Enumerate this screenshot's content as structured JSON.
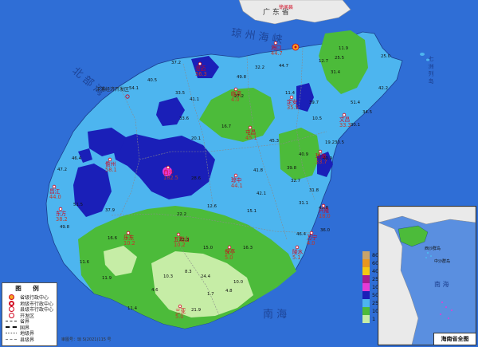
{
  "mainland_label": "广 东 省",
  "county_label": "徐闻县",
  "sea_labels": {
    "strait": "琼 州 海 峡",
    "north": "北 部 湾",
    "south": "南 海"
  },
  "islands_label": "七 洲 列 岛",
  "dev_zone_label": "洋浦经济开发区",
  "cities": [
    {
      "name": "海口",
      "value": "44.7"
    },
    {
      "name": "澄迈",
      "value": "56.3"
    },
    {
      "name": "定安",
      "value": "35.5"
    },
    {
      "name": "文昌",
      "value": "33.3"
    },
    {
      "name": "屯昌",
      "value": "45.1"
    },
    {
      "name": "临高",
      "value": "4.0"
    },
    {
      "name": "儋州",
      "value": "58.1"
    },
    {
      "name": "白沙",
      "value": "182.5"
    },
    {
      "name": "琼中",
      "value": "44.1"
    },
    {
      "name": "琼海",
      "value": "33.7"
    },
    {
      "name": "昌江",
      "value": "44.0"
    },
    {
      "name": "东方",
      "value": "38.2"
    },
    {
      "name": "五指山",
      "value": "10.2"
    },
    {
      "name": "乐东",
      "value": "10.2"
    },
    {
      "name": "保亭",
      "value": "5.0"
    },
    {
      "name": "万宁",
      "value": "4.0"
    },
    {
      "name": "陵水",
      "value": "5.1"
    },
    {
      "name": "三亚",
      "value": "5.0"
    },
    {
      "name": "兴隆",
      "value": "18.0"
    }
  ],
  "station_values": [
    "37.2",
    "40.5",
    "49.8",
    "32.2",
    "44.7",
    "12.7",
    "25.5",
    "25.0",
    "11.9",
    "31.4",
    "54.1",
    "33.5",
    "41.1",
    "27.2",
    "39.7",
    "11.4",
    "51.4",
    "42.2",
    "34.5",
    "10.5",
    "33.6",
    "16.7",
    "30.5",
    "40.9",
    "32.7",
    "41.8",
    "39.8",
    "46.4",
    "47.2",
    "51.5",
    "37.9",
    "49.8",
    "43.8",
    "19.2",
    "31.8",
    "42.1",
    "46.4",
    "22.2",
    "16.6",
    "11.6",
    "15.0",
    "22.3",
    "16.3",
    "10.3",
    "11.9",
    "8.3",
    "10.0",
    "24.4",
    "4.8",
    "1.7",
    "4.6",
    "11.4",
    "21.9",
    "30.1",
    "40.9",
    "20.1",
    "45.3",
    "12.6",
    "15.1",
    "28.6",
    "31.1",
    "36.0"
  ],
  "legend": {
    "title": "图  例",
    "items": [
      {
        "label": "省级行政中心",
        "icon": "star-in-circle-icon"
      },
      {
        "label": "地级市行政中心",
        "icon": "double-circle-icon"
      },
      {
        "label": "县级市行政中心",
        "icon": "circle-dot-icon"
      },
      {
        "label": "开发区",
        "icon": "open-circle-icon"
      },
      {
        "label": "省界",
        "icon": "dash-line-icon"
      },
      {
        "label": "国界",
        "icon": "thick-dash-line-icon"
      },
      {
        "label": "地级界",
        "icon": "dotted-line-icon"
      },
      {
        "label": "县级界",
        "icon": "thin-dash-line-icon"
      }
    ]
  },
  "scale": [
    {
      "label": "800",
      "color": "#c8a36a"
    },
    {
      "label": "600",
      "color": "#e8961e"
    },
    {
      "label": "400",
      "color": "#f3c712"
    },
    {
      "label": "250",
      "color": "#a71a8f"
    },
    {
      "label": "100",
      "color": "#e63ad6"
    },
    {
      "label": "50",
      "color": "#1a1fb8"
    },
    {
      "label": "25",
      "color": "#4db5ef"
    },
    {
      "label": "10",
      "color": "#4cbb3a"
    },
    {
      "label": "1",
      "color": "#c6eda6"
    }
  ],
  "inset": {
    "title": "海南省全图",
    "labels": [
      "西沙群岛",
      "中沙群岛",
      "南 海"
    ]
  },
  "approval_number": "审图号：琼 S(2021)115 号"
}
